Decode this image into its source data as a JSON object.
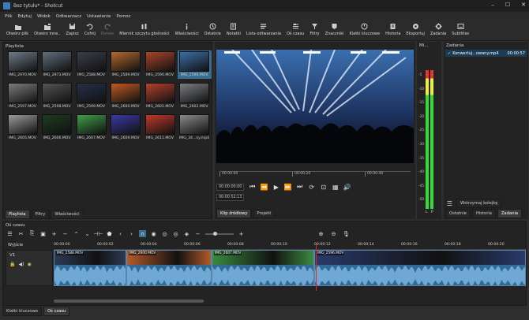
{
  "window": {
    "title": "Bez tytułu* - Shotcut"
  },
  "menu": [
    "Plik",
    "Edytuj",
    "Widok",
    "Odtwarzacz",
    "Ustawienie",
    "Pomoc"
  ],
  "toolbar": [
    {
      "label": "Otwórz plik",
      "icon": "folder-icon"
    },
    {
      "label": "Otwórz inne..",
      "icon": "open-other-icon"
    },
    {
      "label": "Zapisz",
      "icon": "save-icon"
    },
    {
      "label": "Cofnij",
      "icon": "undo-icon"
    },
    {
      "label": "Ponów",
      "icon": "redo-icon",
      "disabled": true
    },
    {
      "label": "Miernik szczytu głośności",
      "icon": "peak-meter-icon"
    },
    {
      "label": "Właściwości",
      "icon": "info-icon"
    },
    {
      "label": "Ostatnie",
      "icon": "clock-icon"
    },
    {
      "label": "Notatki",
      "icon": "notes-icon"
    },
    {
      "label": "Lista odtwarzania",
      "icon": "playlist-icon"
    },
    {
      "label": "Oś czasu",
      "icon": "timeline-icon"
    },
    {
      "label": "Filtry",
      "icon": "filter-icon"
    },
    {
      "label": "Znaczniki",
      "icon": "marker-icon"
    },
    {
      "label": "Klatki kluczowe",
      "icon": "keyframes-icon"
    },
    {
      "label": "Historia",
      "icon": "history-icon"
    },
    {
      "label": "Eksportuj",
      "icon": "export-icon"
    },
    {
      "label": "Zadania",
      "icon": "gear-icon"
    },
    {
      "label": "Subtitles",
      "icon": "subtitles-icon"
    }
  ],
  "playlist": {
    "title": "Playlista",
    "items": [
      {
        "name": "IMG_2970.MOV",
        "color": "#6e7c8a"
      },
      {
        "name": "IMG_2973.MOV",
        "color": "#5f6e7d"
      },
      {
        "name": "IMG_2588.MOV",
        "color": "#3b3f4a"
      },
      {
        "name": "IMG_2589.MOV",
        "color": "#b3692e"
      },
      {
        "name": "IMG_2590.MOV",
        "color": "#a8452a"
      },
      {
        "name": "IMG_2596.MOV",
        "color": "#3c6fa8",
        "selected": true
      },
      {
        "name": "IMG_2597.MOV",
        "color": "#7d7d7d"
      },
      {
        "name": "IMG_2598.MOV",
        "color": "#545454"
      },
      {
        "name": "IMG_2599.MOV",
        "color": "#26304a"
      },
      {
        "name": "IMG_2600.MOV",
        "color": "#c05a25"
      },
      {
        "name": "IMG_2601.MOV",
        "color": "#b3412e"
      },
      {
        "name": "IMG_2602.MOV",
        "color": "#7b7e82"
      },
      {
        "name": "IMG_2605.MOV",
        "color": "#9a9a9a"
      },
      {
        "name": "IMG_2606.MOV",
        "color": "#1d3d22"
      },
      {
        "name": "IMG_2607.MOV",
        "color": "#3fa04a"
      },
      {
        "name": "IMG_2609.MOV",
        "color": "#3a3aa8"
      },
      {
        "name": "IMG_2611.MOV",
        "color": "#c03a2a"
      },
      {
        "name": "IMG_34...ny.mp4",
        "color": "#8a8a8a"
      }
    ],
    "tabs": [
      "Playlista",
      "Filtry",
      "Właściwości"
    ]
  },
  "player": {
    "ruler": [
      "00:00:00",
      "00:00:20",
      "00:00:40"
    ],
    "timecode_in": "00:00:00:00",
    "timecode_out": "00:00:52:13",
    "tabs": [
      "Klip źródłowy",
      "Projekt"
    ]
  },
  "meter": {
    "title": "Mi...",
    "scale": [
      "-5",
      "-10",
      "-15",
      "-20",
      "-25",
      "-30",
      "-35",
      "-40",
      "-45",
      "-50"
    ],
    "channels": [
      "L",
      "P"
    ]
  },
  "tasks": {
    "title": "Zadania",
    "job": "Konwertuj...owany.mp4",
    "job_time": "00:00:57",
    "pause_label": "Wstrzymaj kolejkę",
    "tabs": [
      "Ostatnie",
      "Historia",
      "Zadania"
    ]
  },
  "timeline": {
    "title": "Oś czasu",
    "output_label": "Wyjście",
    "track_name": "V1",
    "ruler": [
      "00:00:00",
      "00:00:02",
      "00:00:04",
      "00:00:06",
      "00:00:08",
      "00:00:10",
      "00:00:12",
      "00:00:14",
      "00:00:16",
      "00:00:18",
      "00:00:20"
    ],
    "clips": [
      {
        "label": "IMG_2588.MOV",
        "color": "#2d3a55"
      },
      {
        "label": "IMG_2600.MOV",
        "color": "#b35a2a"
      },
      {
        "label": "IMG_2607.MOV",
        "color": "#3a8a40"
      },
      {
        "label": "IMG_2596.MOV",
        "color": "#2a3a6a"
      }
    ],
    "bottom_tabs": [
      "Klatki kluczowe",
      "Oś czasu"
    ]
  }
}
